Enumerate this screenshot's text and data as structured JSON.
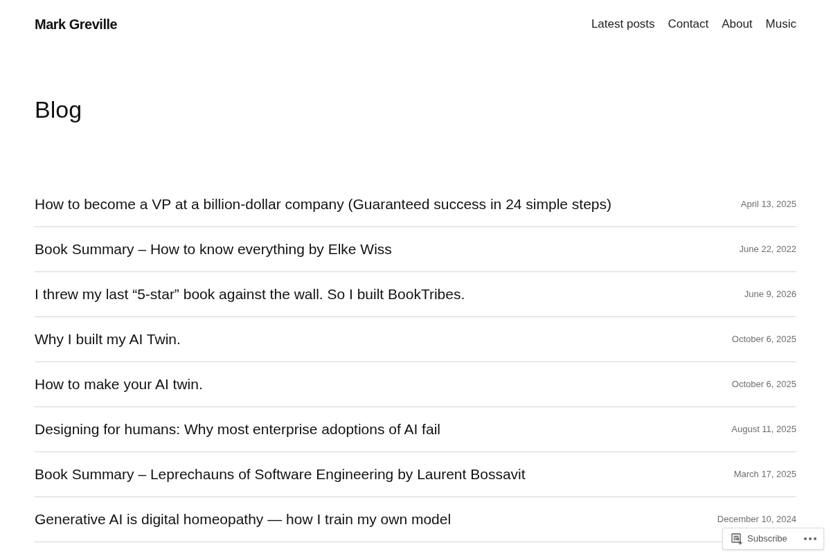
{
  "site": {
    "title": "Mark Greville"
  },
  "nav": [
    "Latest posts",
    "Contact",
    "About",
    "Music"
  ],
  "page": {
    "heading": "Blog"
  },
  "posts": [
    {
      "title": "How to become a VP at a billion-dollar company (Guaranteed success in 24 simple steps)",
      "date": "April 13, 2025"
    },
    {
      "title": "Book Summary – How to know everything by Elke Wiss",
      "date": "June 22, 2022"
    },
    {
      "title": "I threw my last “5-star” book against the wall. So I built BookTribes.",
      "date": "June 9, 2026"
    },
    {
      "title": "Why I built my AI Twin.",
      "date": "October 6, 2025"
    },
    {
      "title": "How to make your AI twin.",
      "date": "October 6, 2025"
    },
    {
      "title": "Designing for humans: Why most enterprise adoptions of AI fail",
      "date": "August 11, 2025"
    },
    {
      "title": "Book Summary – Leprechauns of Software Engineering by Laurent Bossavit",
      "date": "March 17, 2025"
    },
    {
      "title": "Generative AI is digital homeopathy — how I train my own model",
      "date": "December 10, 2024"
    }
  ],
  "subscribe_bar": {
    "label": "Subscribe"
  }
}
